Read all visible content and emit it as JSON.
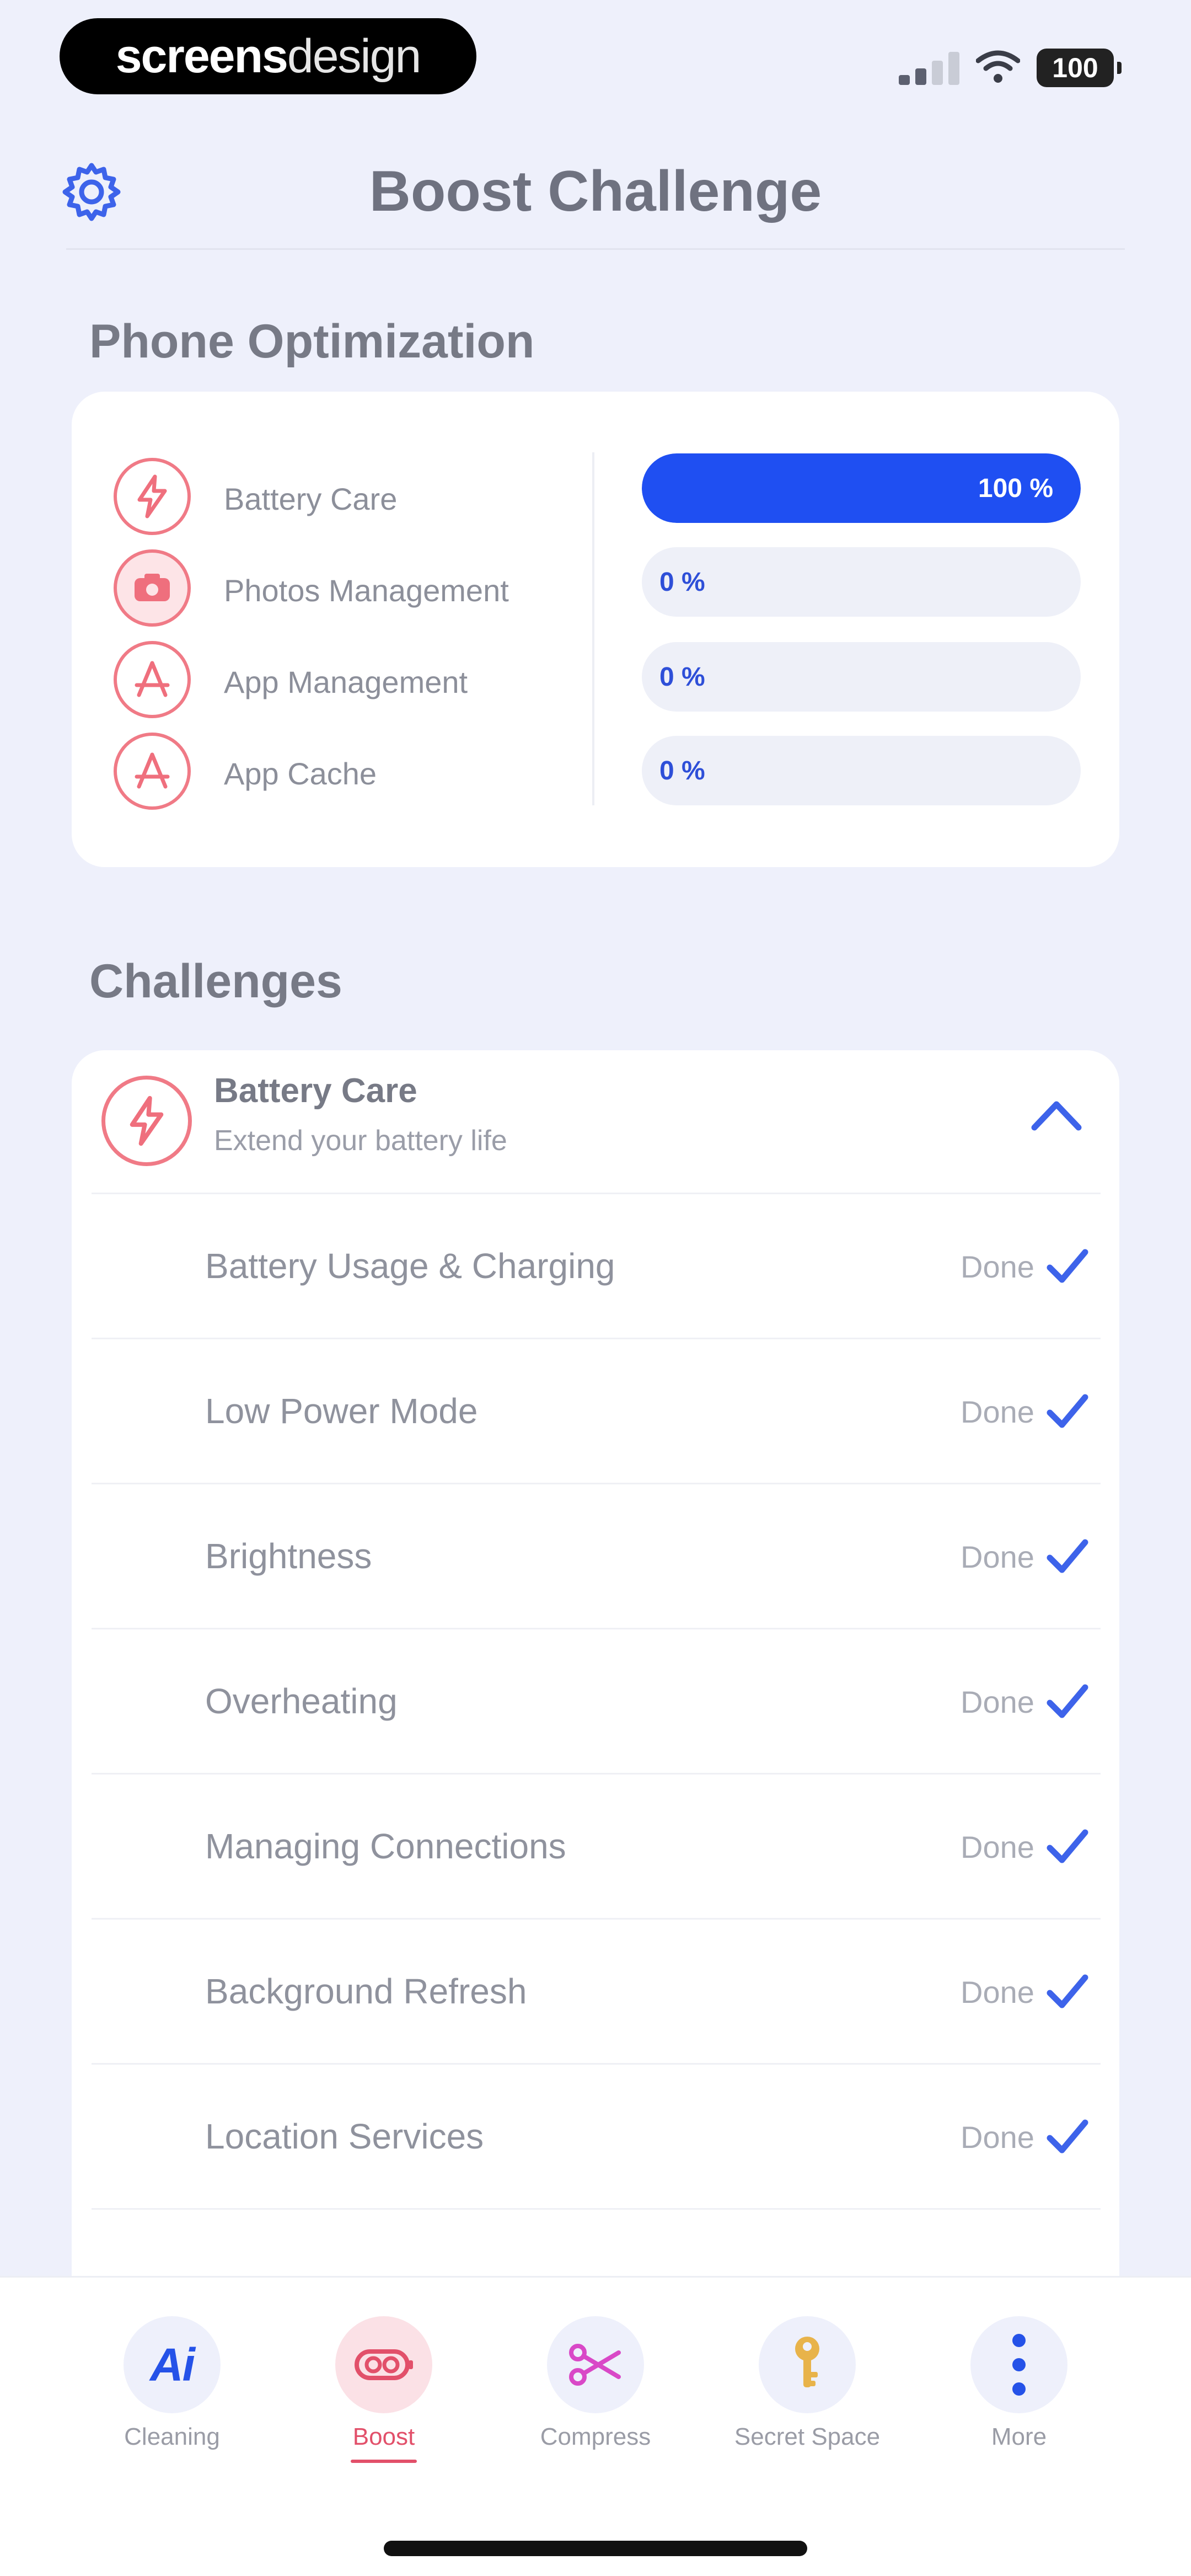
{
  "status_bar": {
    "brand_bold": "screens",
    "brand_light": "design",
    "battery": "100"
  },
  "header": {
    "title": "Boost Challenge"
  },
  "optimization": {
    "section_title": "Phone Optimization",
    "items": [
      {
        "label": "Battery Care",
        "icon": "lightning-icon",
        "percent_text": "100 %",
        "progress": 100
      },
      {
        "label": "Photos Management",
        "icon": "photo-icon",
        "percent_text": "0 %",
        "progress": 0
      },
      {
        "label": "App Management",
        "icon": "app-store-icon",
        "percent_text": "0 %",
        "progress": 0
      },
      {
        "label": "App Cache",
        "icon": "app-store-icon",
        "percent_text": "0 %",
        "progress": 0
      }
    ]
  },
  "challenges": {
    "section_title": "Challenges",
    "group": {
      "title": "Battery Care",
      "subtitle": "Extend your battery life",
      "icon": "lightning-icon",
      "items": [
        {
          "label": "Battery Usage & Charging",
          "status": "Done"
        },
        {
          "label": "Low Power Mode",
          "status": "Done"
        },
        {
          "label": "Brightness",
          "status": "Done"
        },
        {
          "label": "Overheating",
          "status": "Done"
        },
        {
          "label": "Managing Connections",
          "status": "Done"
        },
        {
          "label": "Background Refresh",
          "status": "Done"
        },
        {
          "label": "Location Services",
          "status": "Done"
        }
      ]
    }
  },
  "tab_bar": {
    "tabs": [
      {
        "label": "Cleaning",
        "icon": "ai-icon",
        "glyph": "Ai"
      },
      {
        "label": "Boost",
        "icon": "battery-boost-icon"
      },
      {
        "label": "Compress",
        "icon": "scissors-icon"
      },
      {
        "label": "Secret Space",
        "icon": "key-icon"
      },
      {
        "label": "More",
        "icon": "more-vertical-icon"
      }
    ],
    "active_index": 1
  },
  "colors": {
    "accent_blue": "#1f4ff2",
    "accent_red": "#f07a86",
    "active_tab": "#e2506a",
    "background": "#eef0fb"
  }
}
